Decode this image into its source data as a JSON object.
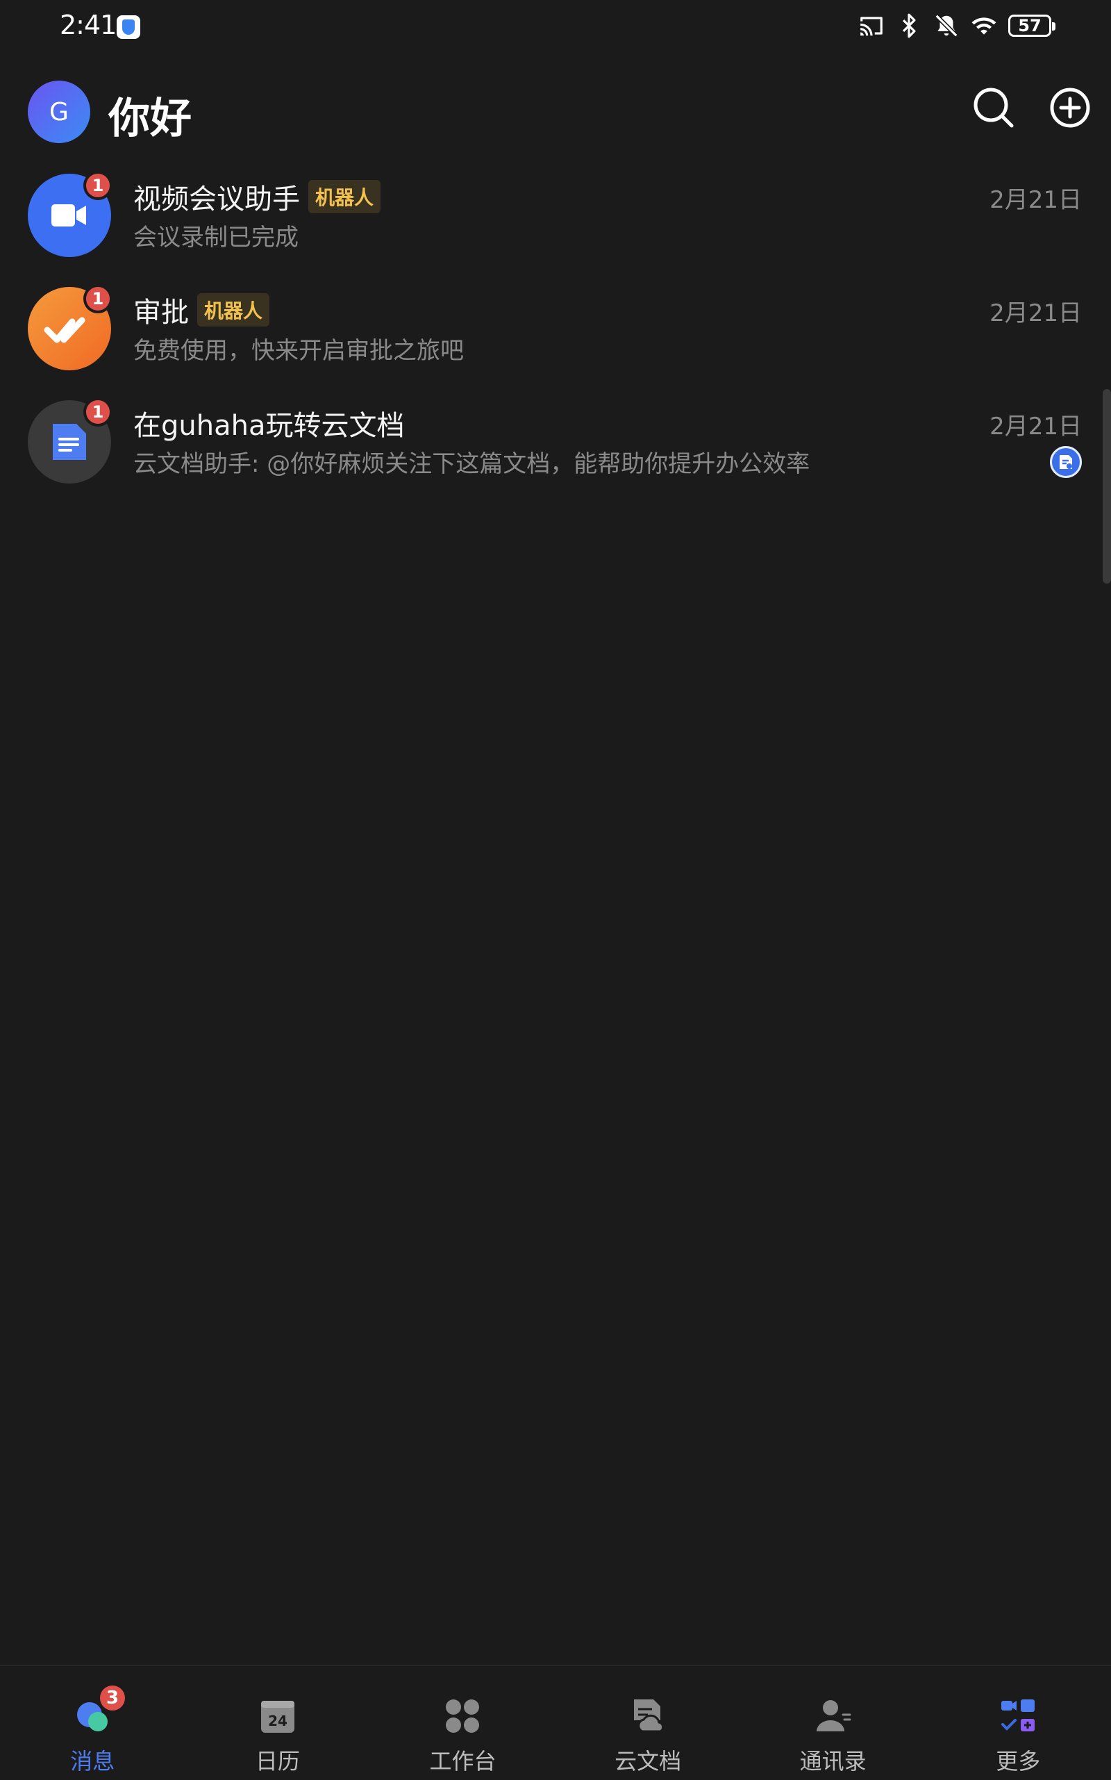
{
  "status_bar": {
    "time": "2:41",
    "battery": "57",
    "icons": [
      "shield-app-icon",
      "cast-icon",
      "bluetooth-icon",
      "mute-icon",
      "wifi-icon",
      "battery-icon"
    ]
  },
  "header": {
    "avatar_letter": "G",
    "title": "你好",
    "icons": [
      "search-icon",
      "add-icon"
    ]
  },
  "chats": [
    {
      "name": "视频会议助手",
      "tag": "机器人",
      "preview": "会议录制已完成",
      "date": "2月21日",
      "unread": "1",
      "avatar_icon": "video-camera-icon",
      "avatar_color": "#3c6ff2"
    },
    {
      "name": "审批",
      "tag": "机器人",
      "preview": "免费使用，快来开启审批之旅吧",
      "date": "2月21日",
      "unread": "1",
      "avatar_icon": "approval-check-icon",
      "avatar_color": "#f47a2e"
    },
    {
      "name": "在guhaha玩转云文档",
      "tag": "",
      "preview": "云文档助手: @你好麻烦关注下这篇文档，能帮助你提升办公效率",
      "date": "2月21日",
      "unread": "1",
      "avatar_icon": "document-icon",
      "avatar_color": "#3a3a3a",
      "badge_icon": "cloud-doc-badge-icon"
    }
  ],
  "bottom_nav": [
    {
      "label": "消息",
      "icon": "messages-icon",
      "active": true,
      "badge": "3"
    },
    {
      "label": "日历",
      "icon": "calendar-icon",
      "active": false,
      "calendar_day": "24"
    },
    {
      "label": "工作台",
      "icon": "workbench-icon",
      "active": false
    },
    {
      "label": "云文档",
      "icon": "cloud-docs-icon",
      "active": false
    },
    {
      "label": "通讯录",
      "icon": "contacts-icon",
      "active": false
    },
    {
      "label": "更多",
      "icon": "more-apps-icon",
      "active": false
    }
  ],
  "colors": {
    "background": "#1b1b1b",
    "accent": "#4e7df2",
    "unread_badge": "#e0504a",
    "bot_tag_text": "#f2c14e"
  }
}
